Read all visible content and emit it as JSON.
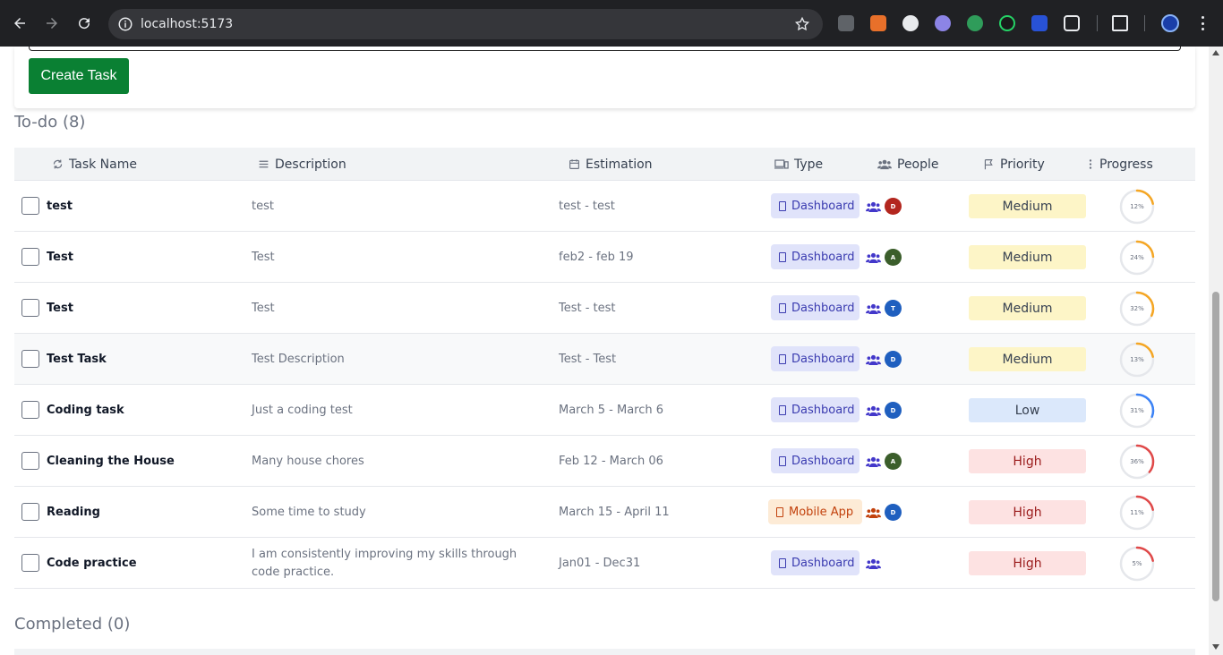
{
  "browser": {
    "url": "localhost:5173"
  },
  "page": {
    "create_button": "Create Task",
    "todo_title": "To-do (8)",
    "completed_title": "Completed (0)"
  },
  "table": {
    "columns": {
      "task_name": "Task Name",
      "description": "Description",
      "estimation": "Estimation",
      "type": "Type",
      "people": "People",
      "priority": "Priority",
      "progress": "Progress"
    },
    "rows": [
      {
        "name": "test",
        "description": "test",
        "estimation": "test - test",
        "type": "Dashboard",
        "avatar": "D",
        "avatar_color": "#b3261e",
        "priority": "Medium",
        "progress": 12,
        "progress_label": "12%",
        "ring_color": "#f5a623"
      },
      {
        "name": "Test",
        "description": "Test",
        "estimation": "feb2 - feb 19",
        "type": "Dashboard",
        "avatar": "A",
        "avatar_color": "#3b5e2b",
        "priority": "Medium",
        "progress": 24,
        "progress_label": "24%",
        "ring_color": "#f5a623"
      },
      {
        "name": "Test",
        "description": "Test",
        "estimation": "Test - test",
        "type": "Dashboard",
        "avatar": "T",
        "avatar_color": "#1f5fbf",
        "priority": "Medium",
        "progress": 32,
        "progress_label": "32%",
        "ring_color": "#f5a623"
      },
      {
        "name": "Test Task",
        "description": "Test Description",
        "estimation": "Test - Test",
        "type": "Dashboard",
        "avatar": "D",
        "avatar_color": "#1f5fbf",
        "priority": "Medium",
        "progress": 13,
        "progress_label": "13%",
        "ring_color": "#f5a623"
      },
      {
        "name": "Coding task",
        "description": "Just a coding test",
        "estimation": "March 5 - March 6",
        "type": "Dashboard",
        "avatar": "D",
        "avatar_color": "#1f5fbf",
        "priority": "Low",
        "progress": 31,
        "progress_label": "31%",
        "ring_color": "#3b82f6"
      },
      {
        "name": "Cleaning the House",
        "description": "Many house chores",
        "estimation": "Feb 12 - March 06",
        "type": "Dashboard",
        "avatar": "A",
        "avatar_color": "#3b5e2b",
        "priority": "High",
        "progress": 36,
        "progress_label": "36%",
        "ring_color": "#e04848"
      },
      {
        "name": "Reading",
        "description": "Some time to study",
        "estimation": "March 15 - April 11",
        "type": "Mobile App",
        "avatar": "D",
        "avatar_color": "#1f5fbf",
        "priority": "High",
        "progress": 11,
        "progress_label": "11%",
        "ring_color": "#e04848"
      },
      {
        "name": "Code practice",
        "description": "I am consistently improving my skills through code practice.",
        "estimation": "Jan01 - Dec31",
        "type": "Dashboard",
        "avatar": "",
        "avatar_color": "",
        "priority": "High",
        "progress": 5,
        "progress_label": "5%",
        "ring_color": "#e04848"
      }
    ]
  },
  "colors": {
    "medium_bg": "#fdf5c7",
    "low_bg": "#dbe8fb",
    "high_bg": "#fde2e2",
    "people_icon": "#4338ca",
    "people_icon_mobile": "#c2410c"
  }
}
